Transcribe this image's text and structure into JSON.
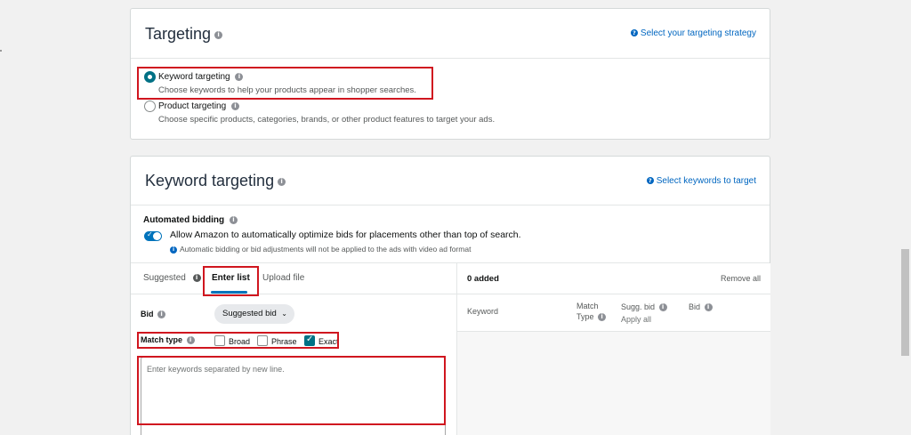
{
  "targeting": {
    "title": "Targeting",
    "help_link": "Select your targeting strategy",
    "options": [
      {
        "label": "Keyword targeting",
        "desc": "Choose keywords to help your products appear in shopper searches.",
        "selected": true
      },
      {
        "label": "Product targeting",
        "desc": "Choose specific products, categories, brands, or other product features to target your ads.",
        "selected": false
      }
    ]
  },
  "keyword_targeting": {
    "title": "Keyword targeting",
    "help_link": "Select keywords to target",
    "auto_bidding": {
      "title": "Automated bidding",
      "toggle_label": "Allow Amazon to automatically optimize bids for placements other than top of search.",
      "note": "Automatic bidding or bid adjustments will not be applied to the ads with video ad format",
      "enabled": true
    },
    "tabs": [
      "Suggested",
      "Enter list",
      "Upload file"
    ],
    "active_tab": "Enter list",
    "bid_label": "Bid",
    "bid_select": "Suggested bid",
    "match_type_label": "Match type",
    "match_types": [
      {
        "label": "Broad",
        "checked": false
      },
      {
        "label": "Phrase",
        "checked": false
      },
      {
        "label": "Exact",
        "checked": true
      }
    ],
    "textarea_placeholder": "Enter keywords separated by new line.",
    "added": {
      "count_label": "0 added",
      "remove_all": "Remove all",
      "columns": {
        "keyword": "Keyword",
        "match_line1": "Match",
        "match_line2": "Type",
        "sugg_bid": "Sugg. bid",
        "apply_all": "Apply all",
        "bid": "Bid"
      }
    }
  },
  "colors": {
    "accent": "#0073bb",
    "link": "#0066c0",
    "highlight": "#d0161f"
  }
}
